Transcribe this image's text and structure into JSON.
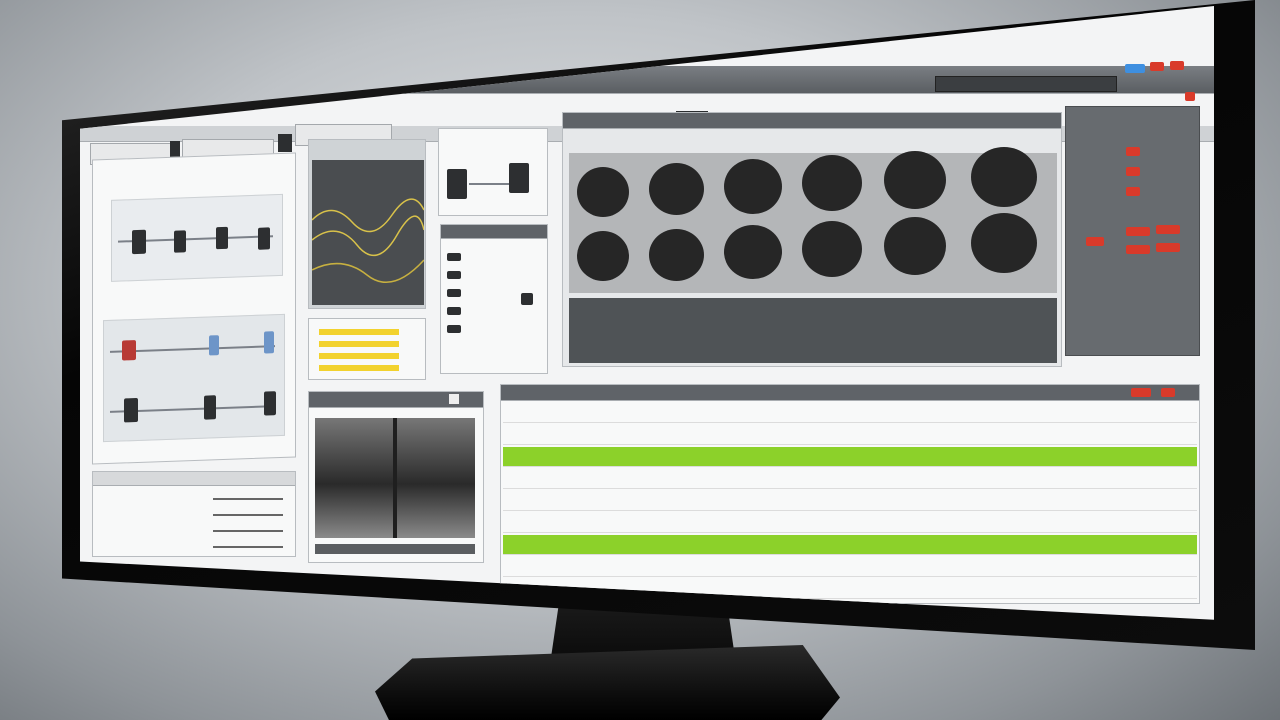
{
  "colors": {
    "green_row": "#8cd12a",
    "yellow_bar": "#f2d22e",
    "red_indicator": "#d93a2a",
    "dark_panel": "#5f6368",
    "circle": "#262626"
  },
  "header": {
    "title": "",
    "toolbar_icons": [
      "window-icon",
      "play-icon",
      "settings-icon"
    ]
  },
  "panels": {
    "left_top": {
      "heading": ""
    },
    "left_bottom": {
      "heading": ""
    },
    "chart_panel": {
      "heading": ""
    },
    "component_panel": {
      "heading": ""
    },
    "list_panel": {
      "heading": ""
    },
    "circle_panel": {
      "heading": ""
    },
    "video_panel": {
      "heading": ""
    },
    "table_panel": {
      "heading": ""
    }
  },
  "yellow_bars": [
    0.9,
    0.9,
    0.9,
    0.9
  ],
  "circle_grid": {
    "rows": 2,
    "cols": 6
  },
  "table": {
    "rows": [
      {
        "highlight": false
      },
      {
        "highlight": false
      },
      {
        "highlight": true
      },
      {
        "highlight": false
      },
      {
        "highlight": false
      },
      {
        "highlight": false
      },
      {
        "highlight": true
      },
      {
        "highlight": false
      },
      {
        "highlight": false
      }
    ]
  }
}
